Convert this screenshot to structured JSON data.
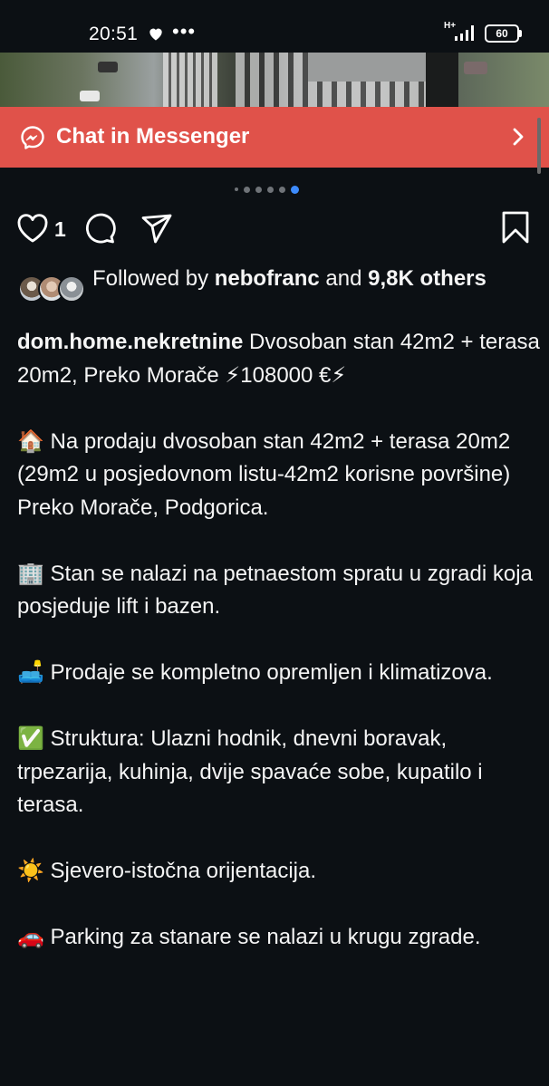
{
  "status_bar": {
    "time": "20:51",
    "dots": "•••",
    "network": "H+",
    "battery": "60"
  },
  "banner": {
    "label": "Chat in Messenger",
    "color": "#e0524a"
  },
  "carousel": {
    "total_dots": 6,
    "active_index": 5
  },
  "actions": {
    "like_count": "1"
  },
  "followed_by": {
    "prefix": "Followed by ",
    "user": "nebofranc",
    "middle": " and ",
    "count": "9,8K",
    "suffix": " others"
  },
  "caption": {
    "username": "dom.home.nekretnine",
    "title": " Dvosoban stan 42m2 + terasa 20m2, Preko Morače ⚡108000 €⚡",
    "paragraphs": [
      "🏠 Na prodaju dvosoban stan 42m2 + terasa 20m2 (29m2 u posjedovnom listu-42m2 korisne površine) Preko Morače, Podgorica.",
      "🏢 Stan se nalazi na petnaestom spratu u zgradi koja posjeduje lift i bazen.",
      "🛋️ Prodaje se kompletno opremljen i klimatizova.",
      "✅ Struktura: Ulazni hodnik, dnevni boravak, trpezarija, kuhinja, dvije spavaće sobe, kupatilo i terasa.",
      "☀️ Sjevero-istočna orijentacija.",
      "🚗 Parking za stanare se nalazi u krugu zgrade."
    ]
  }
}
